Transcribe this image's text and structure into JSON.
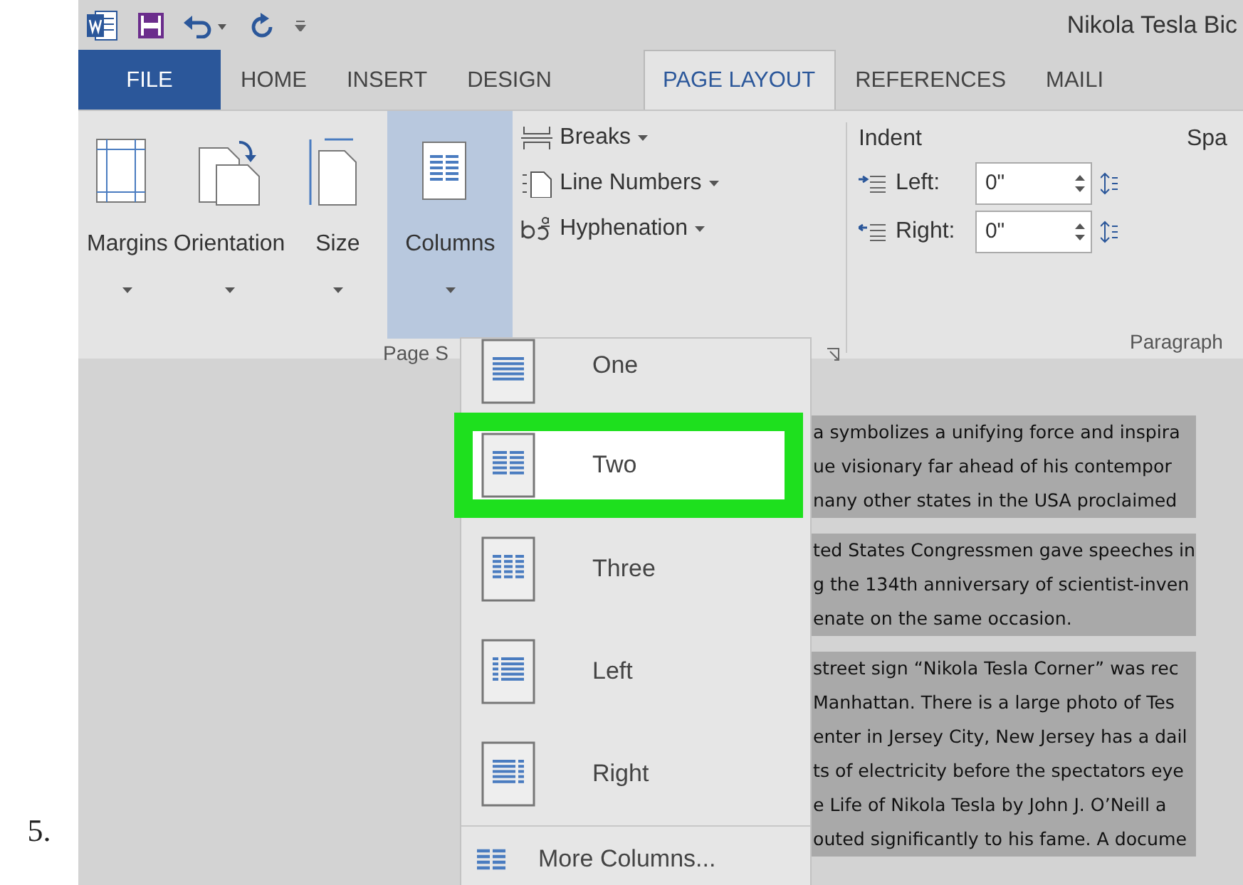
{
  "step_number": "5.",
  "window": {
    "title": "Nikola Tesla Bic"
  },
  "tabs": [
    {
      "label": "FILE",
      "kind": "file",
      "selected": false
    },
    {
      "label": "HOME",
      "kind": "tab",
      "selected": false
    },
    {
      "label": "INSERT",
      "kind": "tab",
      "selected": false
    },
    {
      "label": "DESIGN",
      "kind": "tab",
      "selected": false
    },
    {
      "label": "PAGE LAYOUT",
      "kind": "tab",
      "selected": true
    },
    {
      "label": "REFERENCES",
      "kind": "tab",
      "selected": false
    },
    {
      "label": "MAILI",
      "kind": "tab",
      "selected": false
    }
  ],
  "page_setup": {
    "large_buttons": [
      {
        "label": "Margins",
        "kind": "margins",
        "expanded": false
      },
      {
        "label": "Orientation",
        "kind": "orientation",
        "expanded": false
      },
      {
        "label": "Size",
        "kind": "size",
        "expanded": false
      },
      {
        "label": "Columns",
        "kind": "columns",
        "expanded": true
      }
    ],
    "small_buttons": [
      {
        "label": "Breaks",
        "kind": "breaks"
      },
      {
        "label": "Line Numbers",
        "kind": "line-numbers"
      },
      {
        "label": "Hyphenation",
        "kind": "hyphenation"
      }
    ],
    "group_label": "Page S"
  },
  "paragraph": {
    "indent_label": "Indent",
    "fields": [
      {
        "label": "Left:",
        "kind": "left",
        "value": "0\""
      },
      {
        "label": "Right:",
        "kind": "right",
        "value": "0\""
      }
    ],
    "spacing_label": "Spa",
    "group_label": "Paragraph"
  },
  "columns_menu": {
    "items": [
      {
        "label": "One",
        "kind": "one",
        "highlighted": false
      },
      {
        "label": "Two",
        "kind": "two",
        "highlighted": true
      },
      {
        "label": "Three",
        "kind": "three",
        "highlighted": false
      },
      {
        "label": "Left",
        "kind": "left",
        "highlighted": false
      },
      {
        "label": "Right",
        "kind": "right",
        "highlighted": false
      }
    ],
    "more": "More Columns..."
  },
  "document": {
    "paragraphs": [
      [
        "a symbolizes a unifying force and inspira",
        "ue visionary far ahead of his contempor",
        "nany other states in the USA proclaimed"
      ],
      [
        "ted States Congressmen gave speeches in",
        "g the 134th anniversary of scientist-inven",
        "enate on the same occasion."
      ],
      [
        "street sign “Nikola Tesla Corner” was rec",
        "Manhattan. There is a large photo of Tes",
        "enter in Jersey City, New Jersey has a dail",
        "ts of electricity before the spectators eye",
        "e Life of Nikola Tesla by John J. O’Neill  a",
        "outed significantly to his fame. A docume"
      ]
    ]
  }
}
